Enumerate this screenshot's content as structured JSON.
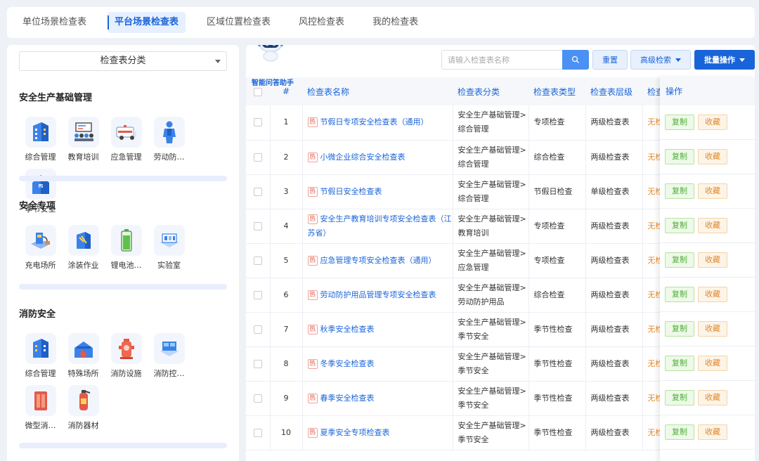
{
  "tabs": [
    {
      "label": "单位场景检查表",
      "active": false
    },
    {
      "label": "平台场景检查表",
      "active": true
    },
    {
      "label": "区域位置检查表",
      "active": false
    },
    {
      "label": "风控检查表",
      "active": false
    },
    {
      "label": "我的检查表",
      "active": false
    }
  ],
  "category_select": {
    "value": "检查表分类"
  },
  "sections": [
    {
      "title": "安全生产基础管理",
      "items": [
        {
          "label": "综合管理",
          "icon": "building-icon"
        },
        {
          "label": "教育培训",
          "icon": "training-icon"
        },
        {
          "label": "应急管理",
          "icon": "ambulance-icon"
        },
        {
          "label": "劳动防…",
          "icon": "protective-suit-icon"
        },
        {
          "label": "季节安全",
          "icon": "house-icon"
        }
      ]
    },
    {
      "title": "安全专项",
      "items": [
        {
          "label": "充电场所",
          "icon": "charging-icon"
        },
        {
          "label": "涂装作业",
          "icon": "painting-icon"
        },
        {
          "label": "锂电池…",
          "icon": "battery-icon"
        },
        {
          "label": "实验室",
          "icon": "lab-icon"
        }
      ]
    },
    {
      "title": "消防安全",
      "items": [
        {
          "label": "综合管理",
          "icon": "building-icon"
        },
        {
          "label": "特殊场所",
          "icon": "fire-building-icon"
        },
        {
          "label": "消防设施",
          "icon": "hydrant-icon"
        },
        {
          "label": "消防控…",
          "icon": "control-room-icon"
        },
        {
          "label": "微型消…",
          "icon": "fire-cabinet-icon"
        },
        {
          "label": "消防器材",
          "icon": "extinguisher-icon"
        }
      ]
    }
  ],
  "assistant": {
    "label": "智能问答助手"
  },
  "toolbar": {
    "search_placeholder": "请输入检查表名称",
    "reset_label": "重置",
    "advanced_label": "高级检索",
    "batch_label": "批量操作"
  },
  "table": {
    "headers": {
      "num": "#",
      "name": "检查表名称",
      "category": "检查表分类",
      "type": "检查表类型",
      "level": "检查表层级",
      "extra": "检查",
      "ops": "操作"
    },
    "hot_tag": "热",
    "copy_label": "复制",
    "fav_label": "收藏",
    "rows": [
      {
        "num": "1",
        "name": "节假日专项安全检查表（通用）",
        "category": "安全生产基础管理>综合管理",
        "type": "专项检查",
        "level": "两级检查表",
        "extra": "无检"
      },
      {
        "num": "2",
        "name": "小微企业综合安全检查表",
        "category": "安全生产基础管理>综合管理",
        "type": "综合检查",
        "level": "两级检查表",
        "extra": "无检"
      },
      {
        "num": "3",
        "name": "节假日安全检查表",
        "category": "安全生产基础管理>综合管理",
        "type": "节假日检查",
        "level": "单级检查表",
        "extra": "无检"
      },
      {
        "num": "4",
        "name": "安全生产教育培训专项安全检查表（江苏省）",
        "category": "安全生产基础管理>教育培训",
        "type": "专项检查",
        "level": "两级检查表",
        "extra": "无检"
      },
      {
        "num": "5",
        "name": "应急管理专项安全检查表（通用）",
        "category": "安全生产基础管理>应急管理",
        "type": "专项检查",
        "level": "两级检查表",
        "extra": "无检"
      },
      {
        "num": "6",
        "name": "劳动防护用品管理专项安全检查表",
        "category": "安全生产基础管理>劳动防护用品",
        "type": "综合检查",
        "level": "两级检查表",
        "extra": "无检"
      },
      {
        "num": "7",
        "name": "秋季安全检查表",
        "category": "安全生产基础管理>季节安全",
        "type": "季节性检查",
        "level": "两级检查表",
        "extra": "无检"
      },
      {
        "num": "8",
        "name": "冬季安全检查表",
        "category": "安全生产基础管理>季节安全",
        "type": "季节性检查",
        "level": "两级检查表",
        "extra": "无检"
      },
      {
        "num": "9",
        "name": "春季安全检查表",
        "category": "安全生产基础管理>季节安全",
        "type": "季节性检查",
        "level": "两级检查表",
        "extra": "无检"
      },
      {
        "num": "10",
        "name": "夏季安全专项检查表",
        "category": "安全生产基础管理>季节安全",
        "type": "季节性检查",
        "level": "两级检查表",
        "extra": "无检"
      }
    ]
  },
  "colors": {
    "primary": "#1a64d9",
    "hot": "#e25a4a",
    "copy": "#4caf36",
    "fav": "#e08a2a"
  }
}
